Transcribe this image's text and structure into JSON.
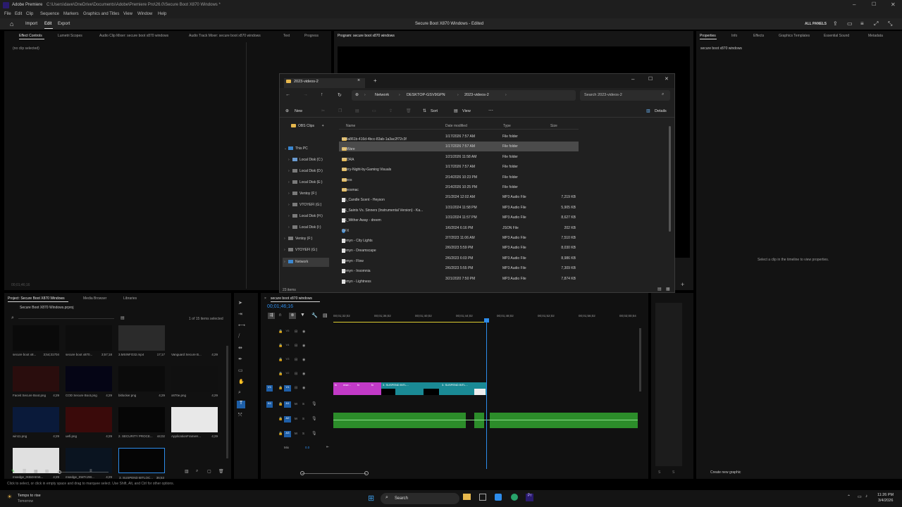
{
  "window": {
    "app_title": "Adobe Premiere",
    "path": "C:\\Users\\dave\\OneDrive\\Documents\\Adobe\\Premiere Pro\\26.0\\Secure Boot X870 Windows *"
  },
  "menu": [
    "File",
    "Edit",
    "Clip",
    "Sequence",
    "Markers",
    "Graphics and Titles",
    "View",
    "Window",
    "Help"
  ],
  "header": {
    "import": "Import",
    "edit": "Edit",
    "export": "Export",
    "project_title": "Secure Boot X870 Windows - Edited",
    "all_panels": "ALL PANELS"
  },
  "top_left_tabs": [
    "Effect Controls",
    "Lumetri Scopes",
    "Audio Clip Mixer: secure boot x870 windows",
    "Audio Track Mixer: secure boot x870 windows",
    "Text",
    "Progress"
  ],
  "no_clip": "(no clip selected)",
  "program_tab": "Program: secure boot x870 windows",
  "right_tabs": [
    "Properties",
    "Info",
    "Effects",
    "Graphics Templates",
    "Essential Sound",
    "Metadata"
  ],
  "properties": {
    "seq_name": "secure boot x870 windows",
    "hint": "Select a clip in the timeline to view properties.",
    "new_graphic": "Create new graphic"
  },
  "timecode_small": "00;01;46;16",
  "explorer": {
    "tab_title": "2023-videos-2",
    "breadcrumb": [
      "Network",
      "DESKTOP-GSV9GPN",
      "2023-videos-2"
    ],
    "search_placeholder": "Search 2023-videos-2",
    "toolbar": {
      "new": "New",
      "sort": "Sort",
      "view": "View",
      "details": "Details"
    },
    "columns": {
      "name": "Name",
      "date": "Date modified",
      "type": "Type",
      "size": "Size"
    },
    "nav_pinned": "OBS Clips",
    "nav": [
      {
        "label": "This PC",
        "level": 0,
        "expanded": true
      },
      {
        "label": "Local Disk (C:)",
        "level": 1
      },
      {
        "label": "Local Disk (D:)",
        "level": 1
      },
      {
        "label": "Local Disk (E:)",
        "level": 1
      },
      {
        "label": "Ventoy (F:)",
        "level": 1
      },
      {
        "label": "VTOYEFI (G:)",
        "level": 1
      },
      {
        "label": "Local Disk (H:)",
        "level": 1
      },
      {
        "label": "Local Disk (I:)",
        "level": 1
      },
      {
        "label": "Ventoy (F:)",
        "level": 0
      },
      {
        "label": "VTOYEFI (G:)",
        "level": 0
      },
      {
        "label": "Network",
        "level": 0,
        "selected": true
      }
    ],
    "rows": [
      {
        "name": "b24a861b-416d-4bcc-83ab-1a3ac2f72c3f",
        "date": "1/17/2026 7:57 AM",
        "type": "File folder",
        "size": "",
        "kind": "folder"
      },
      {
        "name": "SkiWare",
        "date": "1/17/2026 7:57 AM",
        "type": "File folder",
        "size": "",
        "kind": "folder",
        "selected": true
      },
      {
        "name": "HYDRA",
        "date": "1/21/2026 11:58 AM",
        "type": "File folder",
        "size": "",
        "kind": "folder"
      },
      {
        "name": "Starry-Night-by-Gaming Visuals",
        "date": "1/17/2026 7:57 AM",
        "type": "File folder",
        "size": "",
        "kind": "folder"
      },
      {
        "name": "videos",
        "date": "2/14/2026 10:23 PM",
        "type": "File folder",
        "size": "",
        "kind": "folder"
      },
      {
        "name": "videosmac",
        "date": "2/14/2026 10:25 PM",
        "type": "File folder",
        "size": "",
        "kind": "folder"
      },
      {
        "name": "ES_Candle Scent - Heyson",
        "date": "2/1/2024 12:02 AM",
        "type": "MP3 Audio File",
        "size": "7,219 KB",
        "kind": "file"
      },
      {
        "name": "ES_Saints Vs. Sinners (Instrumental Version) - Ka...",
        "date": "1/31/2024 11:58 PM",
        "type": "MP3 Audio File",
        "size": "5,905 KB",
        "kind": "file"
      },
      {
        "name": "ES_Wither Away - dreem",
        "date": "1/31/2024 11:57 PM",
        "type": "MP3 Audio File",
        "size": "8,627 KB",
        "kind": "file"
      },
      {
        "name": "GFX",
        "date": "1/6/2024 6:16 PM",
        "type": "JSON File",
        "size": "202 KB",
        "kind": "json"
      },
      {
        "name": "Nomyn - City Lights",
        "date": "2/7/2023 11:06 AM",
        "type": "MP3 Audio File",
        "size": "7,510 KB",
        "kind": "file"
      },
      {
        "name": "Nomyn - Dreamscape",
        "date": "2/6/2023 5:59 PM",
        "type": "MP3 Audio File",
        "size": "8,030 KB",
        "kind": "file"
      },
      {
        "name": "Nomyn - Flow",
        "date": "2/6/2023 6:03 PM",
        "type": "MP3 Audio File",
        "size": "8,986 KB",
        "kind": "file"
      },
      {
        "name": "Nomyn - Insomnia",
        "date": "2/6/2023 5:55 PM",
        "type": "MP3 Audio File",
        "size": "7,309 KB",
        "kind": "file"
      },
      {
        "name": "Nomyn - Lightness",
        "date": "3/21/2020 7:50 PM",
        "type": "MP3 Audio File",
        "size": "7,874 KB",
        "kind": "file"
      }
    ],
    "status": "23 items"
  },
  "project": {
    "tabs": [
      "Project: Secure Boot X870 Windows",
      "Media Browser",
      "Libraries"
    ],
    "file": "Secure Boot X870 Windows.prproj",
    "selection": "1 of 15 items selected",
    "items": [
      {
        "name": "secure boot x8...",
        "dur": "3;54;31704"
      },
      {
        "name": "secure boot x870...",
        "dur": "3;57;18"
      },
      {
        "name": "3.MSINFO32.mp4",
        "dur": "17;17"
      },
      {
        "name": "Vanguard Secure B...",
        "dur": "4;29"
      },
      {
        "name": "Faceit Secure Boot.png",
        "dur": "4;29"
      },
      {
        "name": "COD Secure Boot.png",
        "dur": "4;29"
      },
      {
        "name": "bitlocker.png",
        "dur": "4;29"
      },
      {
        "name": "x870e.png",
        "dur": "4;29"
      },
      {
        "name": "win11.png",
        "dur": "4;29"
      },
      {
        "name": "uefi.png",
        "dur": "4;29"
      },
      {
        "name": "2. SECURITY PROCE...",
        "dur": "44;02"
      },
      {
        "name": "ApplicationFrameH...",
        "dur": "4;29"
      },
      {
        "name": "msedge_rKB4Hrm6...",
        "dur": "4;29"
      },
      {
        "name": "msedge_SW7c2W...",
        "dur": "4;29"
      },
      {
        "name": "3. SUSPEND BITLOC...",
        "dur": "36;53"
      }
    ]
  },
  "timeline": {
    "seq_tab": "secure boot x870 windows",
    "timecode": "00;01;46;16",
    "ruler": [
      "00;01;32;02",
      "00;01;36;02",
      "00;01;40;02",
      "00;01;44;02",
      "00;01;48;02",
      "00;01;52;02",
      "00;01;56;02",
      "00;02;00;04"
    ],
    "video_tracks": [
      "V5",
      "V4",
      "V3",
      "V2",
      "V1"
    ],
    "audio_tracks": [
      "A1",
      "A2",
      "A3"
    ],
    "mix": "Mix",
    "mix_value": "0.0",
    "clip_labels": [
      "3. SUSPEND BITL...",
      "3. SUSPEND BITL..."
    ]
  },
  "status_hint": "Click to select, or click in empty space and drag to marquee select. Use Shift, Alt, and Ctrl for other options.",
  "taskbar": {
    "weather": "Temps to rise",
    "weather_sub": "Tomorrow",
    "search": "Search",
    "time": "11:26 PM",
    "date": "3/4/2026"
  },
  "colors": {
    "accent": "#2d8ceb",
    "clip_magenta": "#c23ac7",
    "clip_teal": "#1a8a95",
    "audio_green": "#2c8d2a",
    "folder": "#e7b84d"
  }
}
